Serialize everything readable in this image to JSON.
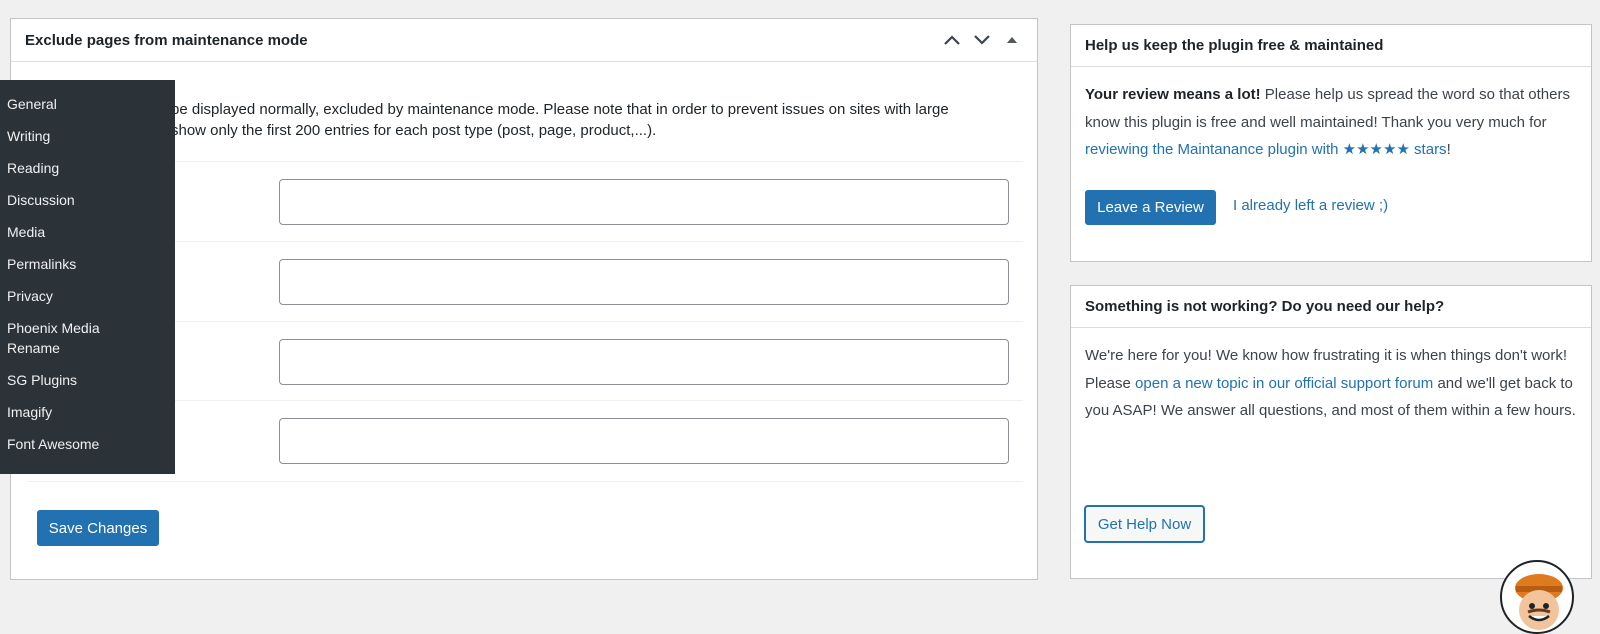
{
  "main": {
    "title": "Exclude pages from maintenance mode",
    "description_line1": "be displayed normally, excluded by maintenance mode. Please note that in order to prevent issues on sites with large",
    "description_line2": "show only the first 200 entries for each post type (post, page, product,...).",
    "save_label": "Save Changes",
    "fields": [
      "",
      "",
      "",
      ""
    ]
  },
  "flyout_menu": {
    "items": [
      "General",
      "Writing",
      "Reading",
      "Discussion",
      "Media",
      "Permalinks",
      "Privacy",
      "Phoenix Media Rename",
      "SG Plugins",
      "Imagify",
      "Font Awesome"
    ]
  },
  "review_box": {
    "title": "Help us keep the plugin free & maintained",
    "bold_text": "Your review means a lot!",
    "text1": " Please help us spread the word so that others know this plugin is free and well maintained! Thank you very much for ",
    "link_text": "reviewing the Maintanance plugin with ★★★★★ stars",
    "text2": "!",
    "leave_review_label": "Leave a Review",
    "already_label": "I already left a review ;)"
  },
  "help_box": {
    "title": "Something is not working? Do you need our help?",
    "line1": "We're here for you! We know how frustrating it is when things don't work!",
    "text_before_link": "Please ",
    "link_text": "open a new topic in our official support forum",
    "text_after_link": " and we'll get back to you ASAP! We answer all questions, and most of them within a few hours.",
    "button_label": "Get Help Now"
  },
  "colors": {
    "accent": "#2271b1",
    "menu_bg": "#2c3338"
  }
}
